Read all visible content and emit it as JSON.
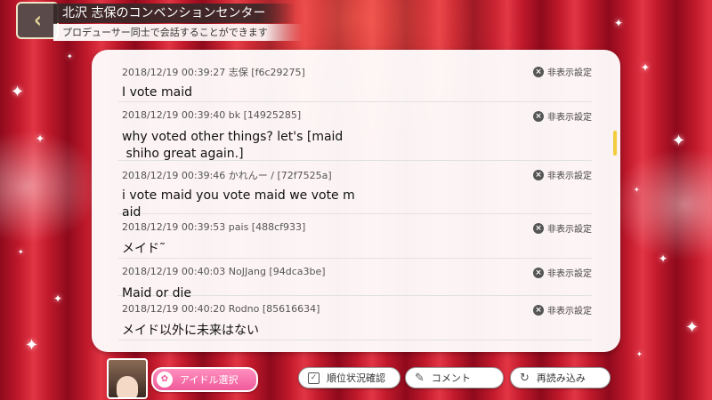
{
  "header": {
    "title": "北沢 志保のコンベンションセンター",
    "subtitle": "プロデューサー同士で会話することができます",
    "back_icon": "chevron-left-icon"
  },
  "messages": [
    {
      "meta": "2018/12/19 00:39:27 志保 [f6c29275]",
      "body": "I vote maid",
      "hide_label": "非表示設定"
    },
    {
      "meta": "2018/12/19 00:39:40 bk [14925285]",
      "body": "why voted other things? let's [maid\n shiho great again.]",
      "hide_label": "非表示設定"
    },
    {
      "meta": "2018/12/19 00:39:46 かれんー / [72f7525a]",
      "body": "i vote maid you vote maid we vote m\naid",
      "hide_label": "非表示設定"
    },
    {
      "meta": "2018/12/19 00:39:53 pais [488cf933]",
      "body": "メイド˜",
      "hide_label": "非表示設定"
    },
    {
      "meta": "2018/12/19 00:40:03 NoJJang [94dca3be]",
      "body": "Maid or die",
      "hide_label": "非表示設定"
    },
    {
      "meta": "2018/12/19 00:40:20 Rodno [85616634]",
      "body": "メイド以外に未来はない",
      "hide_label": "非表示設定"
    }
  ],
  "footer": {
    "idol_select_label": "アイドル選択",
    "ranking_label": "順位状況確認",
    "comment_label": "コメント",
    "reload_label": "再読み込み"
  },
  "colors": {
    "accent_pink": "#f05a9b",
    "scroll_thumb": "#f1cc3d",
    "curtain_red": "#c21a2c"
  }
}
